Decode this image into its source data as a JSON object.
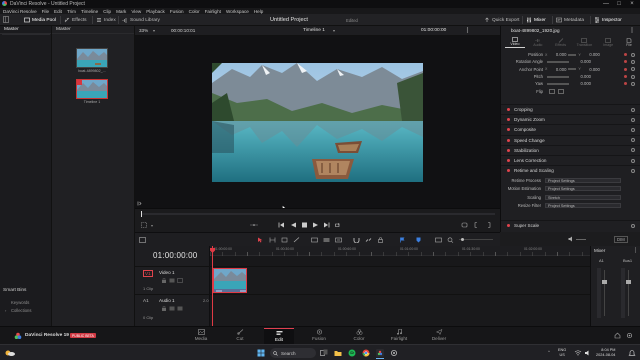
{
  "window": {
    "title": "DaVinci Resolve - Untitled Project",
    "controls": [
      "—",
      "□",
      "×"
    ]
  },
  "menu": [
    "DaVinci Resolve",
    "File",
    "Edit",
    "Trim",
    "Timeline",
    "Clip",
    "Mark",
    "View",
    "Playback",
    "Fusion",
    "Color",
    "Fairlight",
    "Workspace",
    "Help"
  ],
  "toolbar": {
    "media_pool": "Media Pool",
    "effects": "Effects",
    "index": "Index",
    "sound_library": "Sound Library",
    "project_title": "Untitled Project",
    "project_status": "Edited",
    "quick_export": "Quick Export",
    "mixer": "Mixer",
    "metadata": "Metadata",
    "inspector": "Inspector"
  },
  "media": {
    "bins_header": "Master",
    "pool_header": "Master",
    "clips": [
      {
        "name": "boat-4899802_..."
      },
      {
        "name": "Timeline 1"
      }
    ],
    "smart_bins": "Smart Bins",
    "smart_items": [
      "Keywords",
      "Collections"
    ]
  },
  "viewer": {
    "zoom": "33%",
    "timecode_left": "00:00:10:01",
    "timeline_name": "Timeline 1",
    "timecode_right": "01:00:00:00"
  },
  "inspector": {
    "clip_name": "boat-4899802_1920.jpg",
    "tabs": [
      "Video",
      "Audio",
      "Effects",
      "Transition",
      "Image",
      "File"
    ],
    "params": [
      {
        "label": "Position",
        "x": "0.000",
        "y": "0.000"
      },
      {
        "label": "Rotation Angle",
        "x": "0.000",
        "y": ""
      },
      {
        "label": "Anchor Point",
        "x": "0.000",
        "y": "0.000"
      },
      {
        "label": "Pitch",
        "x": "0.000",
        "y": ""
      },
      {
        "label": "Yaw",
        "x": "0.000",
        "y": ""
      },
      {
        "label": "Flip",
        "x": "",
        "y": ""
      }
    ],
    "sections": [
      "Cropping",
      "Dynamic Zoom",
      "Composite",
      "Speed Change",
      "Stabilization",
      "Lens Correction",
      "Retime and Scaling"
    ],
    "retime": [
      {
        "label": "Retime Process",
        "value": "Project Settings"
      },
      {
        "label": "Motion Estimation",
        "value": "Project Settings"
      },
      {
        "label": "Scaling",
        "value": "Stretch"
      },
      {
        "label": "Resize Filter",
        "value": "Project Settings"
      }
    ],
    "super_scale": "Super Scale"
  },
  "timeline": {
    "timecode": "01:00:00:00",
    "ruler": [
      "01:00:00:00",
      "01:00:30:00",
      "01:00:60:00",
      "01:01:00:00",
      "01:01:30:00",
      "01:02:00:00"
    ],
    "tracks": [
      {
        "id": "V1",
        "name": "Video 1",
        "info": "1 Clip"
      },
      {
        "id": "A1",
        "name": "Audio 1",
        "info": "0 Clip",
        "level": "2.0"
      }
    ],
    "dim_label": "DIM"
  },
  "mixer": {
    "title": "Mixer",
    "channels": [
      "A1",
      "Bus1"
    ]
  },
  "brand": {
    "name": "DaVinci Resolve 19",
    "badge": "PUBLIC BETA"
  },
  "pages": [
    "Media",
    "Cut",
    "Edit",
    "Fusion",
    "Color",
    "Fairlight",
    "Deliver"
  ],
  "active_page": "Edit",
  "taskbar": {
    "search": "Search",
    "lang": "ENG",
    "region": "US",
    "time": "8:04 PM",
    "date": "2024-08-04"
  },
  "colors": {
    "accent": "#e04050",
    "timeline_clip": "#6b7fa8",
    "playhead": "#e03a45"
  }
}
